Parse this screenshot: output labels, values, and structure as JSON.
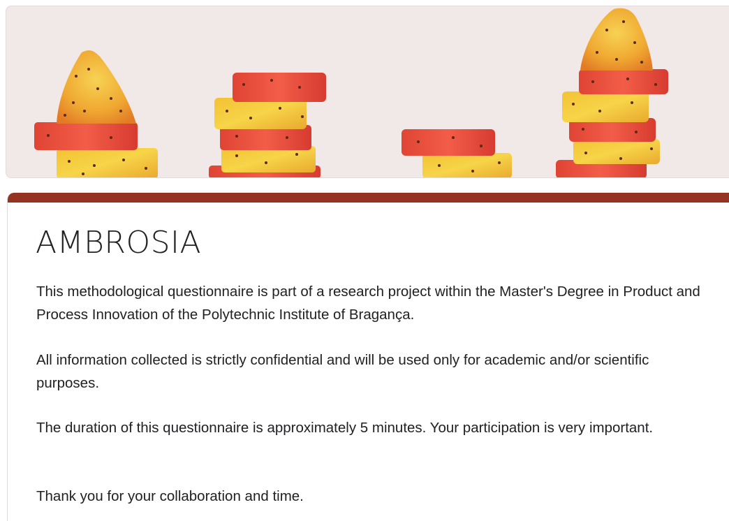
{
  "form": {
    "title": "AMBROSIA",
    "description": [
      "This methodological questionnaire is part of a research project within the Master's Degree in Product and Process Innovation of the Polytechnic Institute of Bragança.",
      "All information collected is strictly confidential and will be used only for academic and/or scientific purposes.",
      "The duration of this questionnaire is approximately 5 minutes. Your participation is very important.",
      "Thank you for your collaboration and time."
    ]
  },
  "header": {
    "image": "prickly-pear-fruit-slices"
  },
  "colors": {
    "accent": "#943322",
    "banner_background": "#f1e9e7",
    "text": "#202124"
  }
}
